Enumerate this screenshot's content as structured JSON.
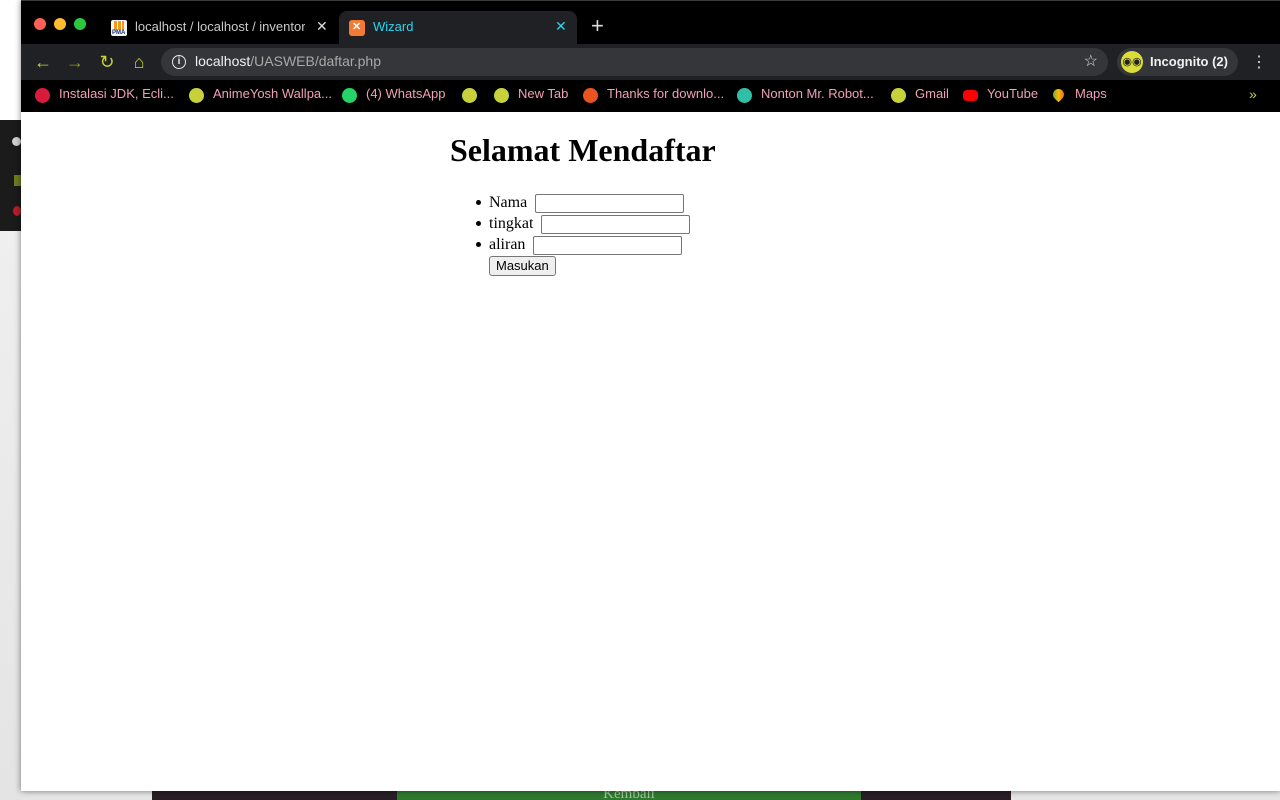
{
  "browser": {
    "tabs": [
      {
        "title": "localhost / localhost / inventory",
        "favicon": "phpmyadmin-icon",
        "active": false
      },
      {
        "title": "Wizard",
        "favicon": "xampp-icon",
        "active": true
      }
    ],
    "address": {
      "host": "localhost",
      "path": "/UASWEB/daftar.php"
    },
    "profile_label": "Incognito (2)",
    "bookmarks": [
      {
        "label": "Instalasi JDK, Ecli...",
        "icon": "red-circle-icon"
      },
      {
        "label": "AnimeYosh Wallpa...",
        "icon": "globe-icon"
      },
      {
        "label": "(4) WhatsApp",
        "icon": "whatsapp-icon"
      },
      {
        "label": "",
        "icon": "globe-icon"
      },
      {
        "label": "New Tab",
        "icon": "globe-icon"
      },
      {
        "label": "Thanks for downlo...",
        "icon": "ubuntu-icon"
      },
      {
        "label": "Nonton Mr. Robot...",
        "icon": "kubernetes-icon"
      },
      {
        "label": "Gmail",
        "icon": "globe-icon"
      },
      {
        "label": "YouTube",
        "icon": "youtube-icon"
      },
      {
        "label": "Maps",
        "icon": "maps-icon"
      }
    ],
    "bookmarks_more": "»"
  },
  "page": {
    "heading": "Selamat Mendaftar",
    "fields": [
      {
        "label": "Nama",
        "value": ""
      },
      {
        "label": "tingkat",
        "value": ""
      },
      {
        "label": "aliran",
        "value": ""
      }
    ],
    "submit_label": "Masukan"
  },
  "background": {
    "text": "Kembali"
  },
  "colors": {
    "accent": "#c8d23a",
    "active_tab_title": "#2ad4f0",
    "bookmark_text": "#f0a0b4"
  }
}
